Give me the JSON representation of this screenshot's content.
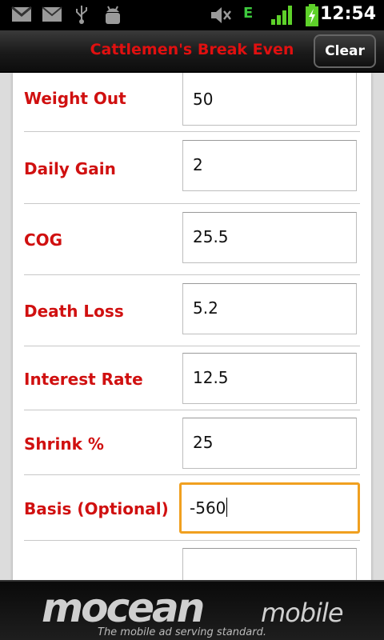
{
  "status_bar": {
    "time": "12:54",
    "icons": [
      "gmail-icon",
      "mail-icon",
      "usb-icon",
      "android-debug-icon",
      "mute-icon",
      "edge-data-icon",
      "signal-icon",
      "battery-charging-icon"
    ],
    "network_label": "E"
  },
  "app": {
    "title": "Cattlemen's Break Even",
    "clear_label": "Clear"
  },
  "form": {
    "fields": [
      {
        "label": "Weight Out",
        "value": "50"
      },
      {
        "label": "Daily Gain",
        "value": "2"
      },
      {
        "label": "COG",
        "value": "25.5"
      },
      {
        "label": "Death Loss",
        "value": "5.2"
      },
      {
        "label": "Interest Rate",
        "value": "12.5"
      },
      {
        "label": "Shrink %",
        "value": "25"
      },
      {
        "label": "Basis (Optional)",
        "value": "-560",
        "focused": true
      }
    ]
  },
  "ad": {
    "brand": "mocean",
    "brand_suffix": "mobile",
    "tagline": "The mobile ad serving standard."
  },
  "colors": {
    "label_red": "#d01010",
    "title_red": "#e01010",
    "focus_orange": "#f0a020"
  }
}
